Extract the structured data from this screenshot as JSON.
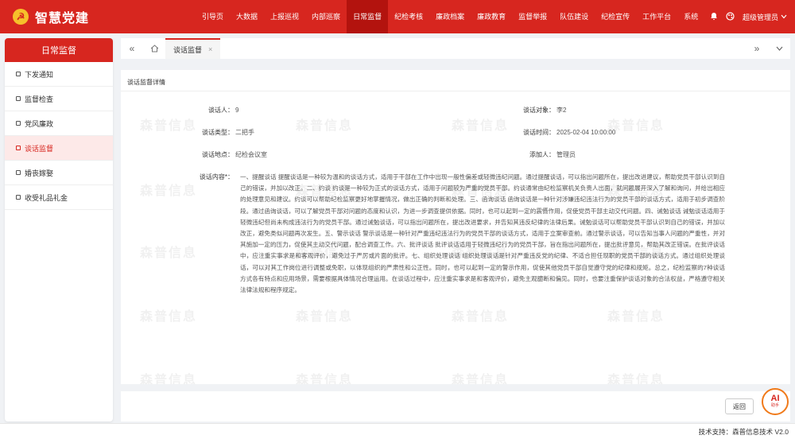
{
  "app": {
    "brand_icon": "☭",
    "title": "智慧党建"
  },
  "nav": {
    "items": [
      "引导页",
      "大数据",
      "上报巡视",
      "内部巡察",
      "日常监督",
      "纪检考核",
      "廉政档案",
      "廉政教育",
      "监督举报",
      "队伍建设",
      "纪检宣传",
      "工作平台",
      "系统"
    ],
    "active_index": 4,
    "user": "超级管理员"
  },
  "sidebar": {
    "title": "日常监督",
    "items": [
      {
        "label": "下发通知"
      },
      {
        "label": "监督检查"
      },
      {
        "label": "党风廉政"
      },
      {
        "label": "谈话监督"
      },
      {
        "label": "婚丧嫁娶"
      },
      {
        "label": "收受礼品礼金"
      }
    ],
    "active_index": 3
  },
  "tabs": {
    "active_label": "谈话监督",
    "close": "×"
  },
  "panel": {
    "title": "谈话监督详情",
    "fields": {
      "speaker_label": "谈话人：",
      "speaker_value": "9",
      "target_label": "谈话对象：",
      "target_value": "李2",
      "type_label": "谈话类型：",
      "type_value": "二把手",
      "time_label": "谈话时间：",
      "time_value": "2025-02-04 10:00:00",
      "place_label": "谈话地点：",
      "place_value": "纪检会议室",
      "adder_label": "添加人：",
      "adder_value": "管理员",
      "content_label": "谈话内容*："
    },
    "content": "一、提醒谈话 提醒谈话是一种较为温和的谈话方式，适用于干部在工作中出现一般性偏差或轻微违纪问题。通过提醒谈话，可以指出问题所在，提出改进建议，帮助党员干部认识到自己的错误，并加以改正。二、约谈 约谈是一种较为正式的谈话方式，适用于问题较为严重的党员干部。约谈通常由纪检监察机关负责人出面，就问题展开深入了解和询问，并给出相应的处理意见和建议。约谈可以帮助纪检监察更好地掌握情况，做出正确的判断和处理。三、函询谈话 函询谈话是一种针对涉嫌违纪违法行为的党员干部的谈话方式，适用于初步调查阶段。通过函询谈话，可以了解党员干部对问题的态度和认识，为进一步调查提供依据。同时，也可以起到一定的震慑作用，促使党员干部主动交代问题。四、诫勉谈话 诫勉谈话适用于轻微违纪但尚未构成违法行为的党员干部。通过诫勉谈话，可以指出问题所在，提出改进要求，并告知其违反纪律的法律后果。诫勉谈话可以帮助党员干部认识到自己的错误，并加以改正，避免类似问题再次发生。五、警示谈话 警示谈话是一种针对严重违纪违法行为的党员干部的谈话方式，适用于立案审查前。通过警示谈话，可以告知当事人问题的严重性，并对其施加一定的压力，促使其主动交代问题，配合调查工作。六、批评谈话 批评谈话适用于轻微违纪行为的党员干部，旨在指出问题所在，提出批评意见，帮助其改正错误。在批评谈话中，应注重实事求是和客观评价，避免过于严厉或片面的批评。七、组织处理谈话 组织处理谈话是针对严重违反党的纪律、不适合担任现职的党员干部的谈话方式。通过组织处理谈话，可以对其工作岗位进行调整或免职，以体现组织的严肃性和公正性。同时，也可以起到一定的警示作用，促使其他党员干部自觉遵守党的纪律和规矩。总之，纪检监察的7种谈话方式各有特点和应用场景，需要根据具体情况合理运用。在谈话过程中，应注重实事求是和客观评价，避免主观臆断和偏见。同时，也要注重保护谈话对象的合法权益，严格遵守相关法律法规和程序规定。"
  },
  "watermark": "森普信息",
  "actions": {
    "back_label": "返回"
  },
  "ai_badge": {
    "label": "AI",
    "sub": "助手"
  },
  "footer": {
    "text": "技术支持：森普信息技术 V2.0"
  },
  "colors": {
    "brand_red": "#d7261f",
    "active_nav": "#b3130e",
    "sidebar_active_bg": "#fde9e8"
  }
}
